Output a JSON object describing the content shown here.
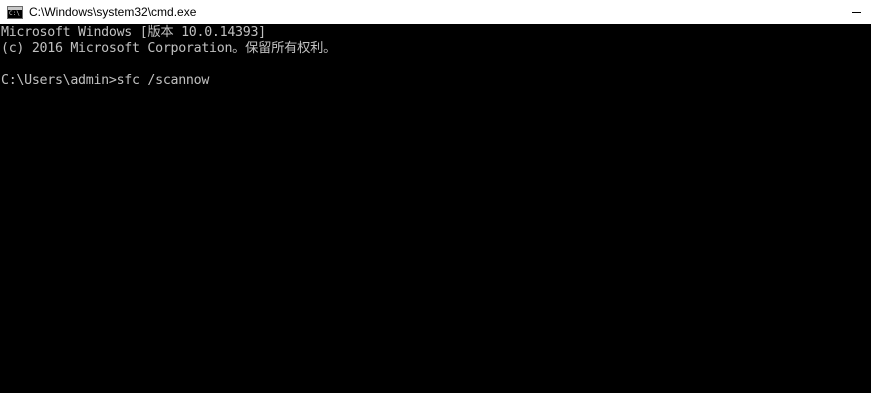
{
  "window": {
    "title": "C:\\Windows\\system32\\cmd.exe",
    "icon": "cmd-icon",
    "minimize_icon": "minimize-icon"
  },
  "console": {
    "lines": [
      "Microsoft Windows [版本 10.0.14393]",
      "(c) 2016 Microsoft Corporation。保留所有权利。",
      "",
      "C:\\Users\\admin>sfc /scannow"
    ]
  },
  "colors": {
    "background": "#000000",
    "text": "#c0c0c0",
    "titlebar": "#ffffff"
  }
}
